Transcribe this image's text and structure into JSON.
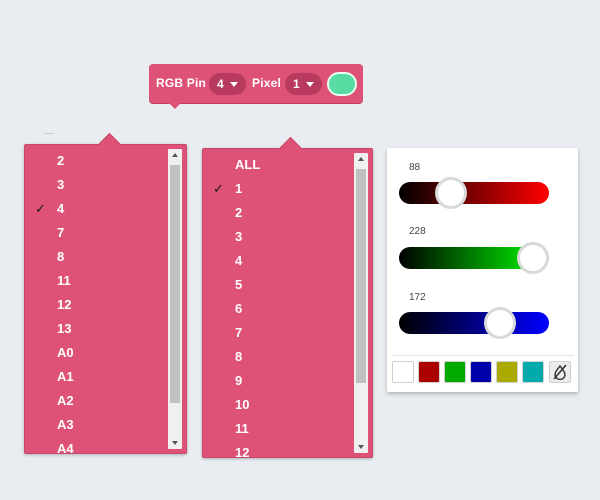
{
  "block": {
    "label1": "RGB Pin",
    "pin_value": "4",
    "label2": "Pixel",
    "pixel_value": "1",
    "color": "#58dca4"
  },
  "pin_menu": {
    "selected": "4",
    "items": [
      "2",
      "3",
      "4",
      "7",
      "8",
      "11",
      "12",
      "13",
      "A0",
      "A1",
      "A2",
      "A3",
      "A4"
    ]
  },
  "pixel_menu": {
    "selected": "1",
    "items": [
      "ALL",
      "1",
      "2",
      "3",
      "4",
      "5",
      "6",
      "7",
      "8",
      "9",
      "10",
      "11",
      "12"
    ]
  },
  "color_picker": {
    "red": "88",
    "green": "228",
    "blue": "172",
    "red_level": 0.345,
    "green_level": 0.894,
    "blue_level": 0.675,
    "swatches": [
      "#ffffff",
      "#aa0000",
      "#00aa00",
      "#0000aa",
      "#aaaa00",
      "#00aaaa"
    ],
    "no_color_icon": "no-color-icon"
  },
  "colors": {
    "block": "#de5277",
    "block_dark": "#b83a5e"
  }
}
